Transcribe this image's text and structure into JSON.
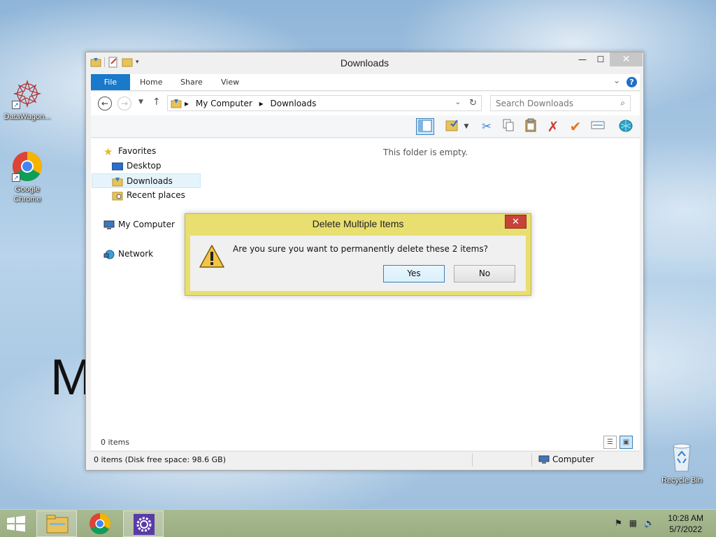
{
  "desktop": {
    "background_text": "M",
    "icons": [
      {
        "label": "DataWagon..."
      },
      {
        "label": "Google Chrome"
      },
      {
        "label": "Recycle Bin"
      }
    ]
  },
  "window": {
    "title": "Downloads",
    "ribbon": {
      "tabs": [
        "File",
        "Home",
        "Share",
        "View"
      ],
      "help_label": "?"
    },
    "address": {
      "crumbs": [
        "My Computer",
        "Downloads"
      ],
      "search_placeholder": "Search Downloads"
    },
    "nav": {
      "favorites_label": "Favorites",
      "items": [
        "Desktop",
        "Downloads",
        "Recent places"
      ],
      "my_computer_label": "My Computer",
      "network_label": "Network"
    },
    "empty_message": "This folder is empty.",
    "item_count": "0 items",
    "status": {
      "left": "0 items (Disk free space: 98.6 GB)",
      "right": "Computer"
    }
  },
  "dialog": {
    "title": "Delete Multiple Items",
    "message": "Are you sure you want to permanently delete these 2 items?",
    "yes_label": "Yes",
    "no_label": "No",
    "close_glyph": "✕"
  },
  "taskbar": {
    "time": "10:28 AM",
    "date": "5/7/2022"
  },
  "colors": {
    "ribbon_file": "#1979ca",
    "dialog_frame": "#e8df70",
    "taskbar": "#9aad83"
  }
}
